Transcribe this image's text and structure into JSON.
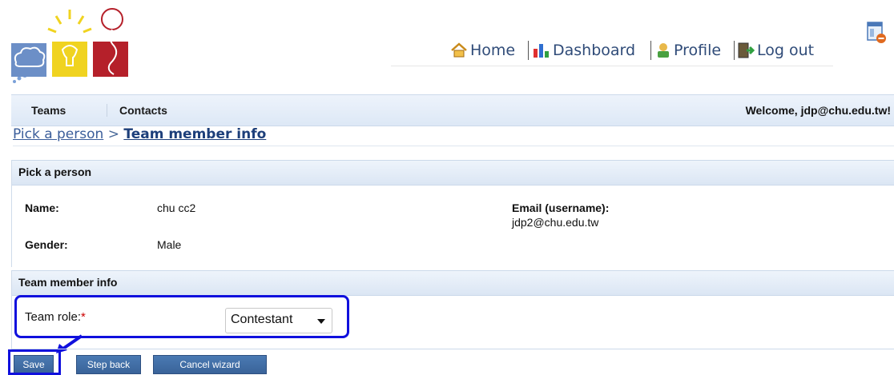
{
  "nav": {
    "home": "Home",
    "dashboard": "Dashboard",
    "profile": "Profile",
    "logout": "Log out"
  },
  "menu": {
    "teams": "Teams",
    "contacts": "Contacts",
    "welcome": "Welcome, jdp@chu.edu.tw!"
  },
  "breadcrumb": {
    "parent": "Pick a person",
    "separator": ">",
    "current": "Team member info"
  },
  "pick_person": {
    "title": "Pick a person",
    "name_label": "Name:",
    "name_value": "chu cc2",
    "gender_label": "Gender:",
    "gender_value": "Male",
    "email_label": "Email (username):",
    "email_value": "jdp2@chu.edu.tw"
  },
  "team_member": {
    "title": "Team member info",
    "role_label": "Team role:",
    "required_mark": "*",
    "role_value": "Contestant"
  },
  "buttons": {
    "save": "Save",
    "step_back": "Step back",
    "cancel": "Cancel wizard"
  },
  "colors": {
    "highlight": "#1010dd",
    "button": "#3a6399"
  }
}
